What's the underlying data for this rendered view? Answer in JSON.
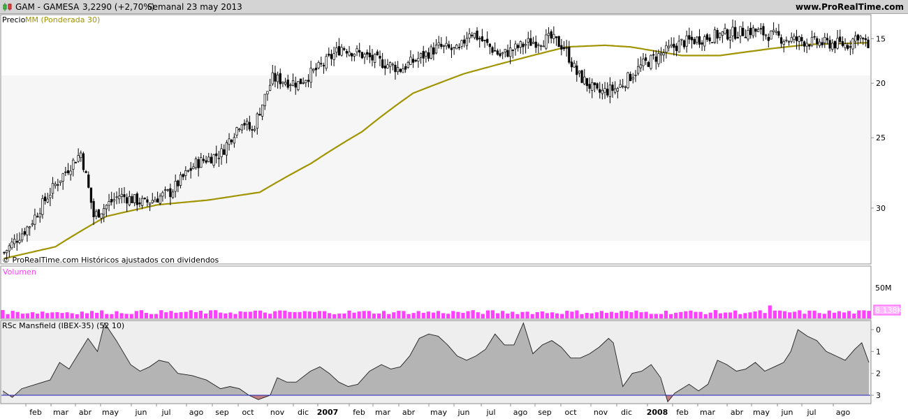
{
  "header": {
    "symbol": "GAM - GAMESA",
    "price": "3,2290 (+2,70%)",
    "timeframe": "Semanal  23 may 2013",
    "site": "www.ProRealTime.com"
  },
  "colors": {
    "header_bg": "#d4d4d4",
    "candle_up_fill": "#ffffff",
    "candle_down_fill": "#000000",
    "ma_line": "#a09400",
    "volume_bar": "#ff40ff",
    "rsc_area": "#b4b4b4",
    "rsc_negative": "#c08080",
    "zero_line": "#2020c0",
    "band": "#f6f6f6"
  },
  "price_panel": {
    "legend_prefix": "Precio",
    "legend_ma": "MM (Ponderada 30)",
    "footer": "© ProRealTime.com  Históricos ajustados con dividendos",
    "y_ticks": [
      "30",
      "25",
      "20",
      "15"
    ]
  },
  "volume_panel": {
    "title": "Volumen",
    "scale_label": "50M",
    "last_value": "8.138K"
  },
  "rsc_panel": {
    "title": "RSc Mansfield (IBEX-35) (52 10)",
    "y_ticks": [
      "3",
      "2",
      "1",
      "0"
    ]
  },
  "x_axis": {
    "labels": [
      "feb",
      "mar",
      "abr",
      "may",
      "jun",
      "jul",
      "ago",
      "sep",
      "oct",
      "nov",
      "dic",
      "2007",
      "feb",
      "mar",
      "abr",
      "may",
      "jun",
      "jul",
      "ago",
      "sep",
      "oct",
      "nov",
      "dic",
      "2008",
      "feb",
      "mar",
      "abr",
      "may",
      "jun",
      "jul",
      "ago"
    ],
    "bold_labels": [
      "2007",
      "2008"
    ]
  },
  "chart_data": [
    {
      "type": "candlestick",
      "title": "GAM - GAMESA",
      "frequency": "weekly",
      "y_scale": "log",
      "ylim": [
        12,
        33
      ],
      "y_ticks": [
        15,
        20,
        25,
        30
      ],
      "series": [
        {
          "name": "Precio",
          "close_anchors": [
            [
              0,
              12.5
            ],
            [
              10,
              14.0
            ],
            [
              20,
              16.5
            ],
            [
              30,
              18.8
            ],
            [
              35,
              14.5
            ],
            [
              45,
              15.8
            ],
            [
              55,
              15.3
            ],
            [
              65,
              16.0
            ],
            [
              75,
              18.0
            ],
            [
              85,
              18.8
            ],
            [
              93,
              21.5
            ],
            [
              97,
              20.5
            ],
            [
              105,
              25.5
            ],
            [
              115,
              25.0
            ],
            [
              125,
              27.0
            ],
            [
              132,
              29.0
            ],
            [
              145,
              27.5
            ],
            [
              155,
              26.5
            ],
            [
              170,
              29.0
            ],
            [
              178,
              28.5
            ],
            [
              182,
              31.0
            ],
            [
              194,
              28.0
            ],
            [
              205,
              29.5
            ],
            [
              214,
              30.0
            ],
            [
              219,
              29.0
            ],
            [
              224,
              26.0
            ],
            [
              232,
              24.0
            ],
            [
              240,
              24.5
            ],
            [
              250,
              27.0
            ],
            [
              265,
              29.5
            ],
            [
              280,
              30.5
            ],
            [
              293,
              31.0
            ],
            [
              305,
              30.0
            ],
            [
              318,
              29.5
            ],
            [
              330,
              29.3
            ],
            [
              334,
              30.5
            ],
            [
              338,
              29.0
            ]
          ]
        },
        {
          "name": "MM (Ponderada 30)",
          "close_anchors": [
            [
              0,
              12.2
            ],
            [
              20,
              12.8
            ],
            [
              40,
              14.5
            ],
            [
              60,
              15.2
            ],
            [
              80,
              15.5
            ],
            [
              100,
              16.0
            ],
            [
              120,
              18.0
            ],
            [
              140,
              20.5
            ],
            [
              160,
              24.0
            ],
            [
              180,
              26.0
            ],
            [
              200,
              27.5
            ],
            [
              220,
              29.0
            ],
            [
              235,
              29.2
            ],
            [
              245,
              29.0
            ],
            [
              265,
              28.0
            ],
            [
              280,
              28.0
            ],
            [
              300,
              28.8
            ],
            [
              315,
              29.3
            ],
            [
              338,
              29.5
            ]
          ]
        }
      ]
    },
    {
      "type": "bar",
      "title": "Volumen",
      "ylim": [
        0,
        50
      ],
      "y_ticks": [
        50
      ],
      "last_value": "8.138K"
    },
    {
      "type": "area",
      "title": "RSc Mansfield (IBEX-35) (52 10)",
      "ylim": [
        -0.3,
        3.3
      ],
      "y_ticks": [
        0,
        1,
        2,
        3
      ],
      "series": [
        {
          "name": "RSc Mansfield (IBEX-35)",
          "points": [
            [
              0,
              0.2
            ],
            [
              4,
              -0.1
            ],
            [
              8,
              0.3
            ],
            [
              14,
              0.5
            ],
            [
              20,
              0.7
            ],
            [
              24,
              1.5
            ],
            [
              28,
              1.2
            ],
            [
              32,
              1.9
            ],
            [
              36,
              2.6
            ],
            [
              40,
              2.0
            ],
            [
              43,
              3.3
            ],
            [
              48,
              2.5
            ],
            [
              54,
              1.4
            ],
            [
              58,
              1.1
            ],
            [
              62,
              1.3
            ],
            [
              66,
              1.6
            ],
            [
              70,
              1.5
            ],
            [
              74,
              1.0
            ],
            [
              80,
              0.9
            ],
            [
              86,
              0.7
            ],
            [
              92,
              0.3
            ],
            [
              96,
              0.4
            ],
            [
              100,
              0.3
            ],
            [
              104,
              0.0
            ],
            [
              108,
              -0.2
            ],
            [
              113,
              0.0
            ],
            [
              116,
              0.8
            ],
            [
              120,
              0.6
            ],
            [
              124,
              0.6
            ],
            [
              130,
              1.1
            ],
            [
              134,
              1.3
            ],
            [
              138,
              1.0
            ],
            [
              142,
              0.6
            ],
            [
              146,
              0.4
            ],
            [
              150,
              0.5
            ],
            [
              155,
              1.1
            ],
            [
              160,
              1.4
            ],
            [
              164,
              1.2
            ],
            [
              168,
              1.3
            ],
            [
              172,
              1.8
            ],
            [
              176,
              2.6
            ],
            [
              180,
              2.8
            ],
            [
              184,
              2.7
            ],
            [
              188,
              2.3
            ],
            [
              192,
              1.8
            ],
            [
              196,
              1.6
            ],
            [
              200,
              1.8
            ],
            [
              204,
              2.1
            ],
            [
              208,
              2.8
            ],
            [
              212,
              2.3
            ],
            [
              216,
              2.3
            ],
            [
              220,
              3.3
            ],
            [
              224,
              1.9
            ],
            [
              228,
              2.3
            ],
            [
              232,
              2.5
            ],
            [
              236,
              2.2
            ],
            [
              240,
              1.7
            ],
            [
              244,
              1.7
            ],
            [
              248,
              1.9
            ],
            [
              252,
              2.2
            ],
            [
              256,
              2.6
            ],
            [
              258,
              2.4
            ],
            [
              262,
              0.4
            ],
            [
              266,
              1.0
            ],
            [
              270,
              1.1
            ],
            [
              274,
              1.4
            ],
            [
              278,
              0.8
            ],
            [
              281,
              -0.3
            ],
            [
              284,
              0.1
            ],
            [
              290,
              0.5
            ],
            [
              294,
              0.2
            ],
            [
              298,
              0.5
            ],
            [
              302,
              1.6
            ],
            [
              306,
              1.4
            ],
            [
              310,
              1.1
            ],
            [
              314,
              1.2
            ],
            [
              318,
              1.5
            ],
            [
              322,
              1.1
            ],
            [
              326,
              1.3
            ],
            [
              330,
              1.5
            ],
            [
              333,
              2.0
            ],
            [
              336,
              3.0
            ],
            [
              340,
              2.7
            ],
            [
              344,
              2.5
            ],
            [
              348,
              2.0
            ],
            [
              352,
              1.8
            ],
            [
              356,
              1.6
            ],
            [
              360,
              2.1
            ],
            [
              363,
              2.4
            ],
            [
              366,
              1.5
            ]
          ]
        }
      ]
    }
  ]
}
